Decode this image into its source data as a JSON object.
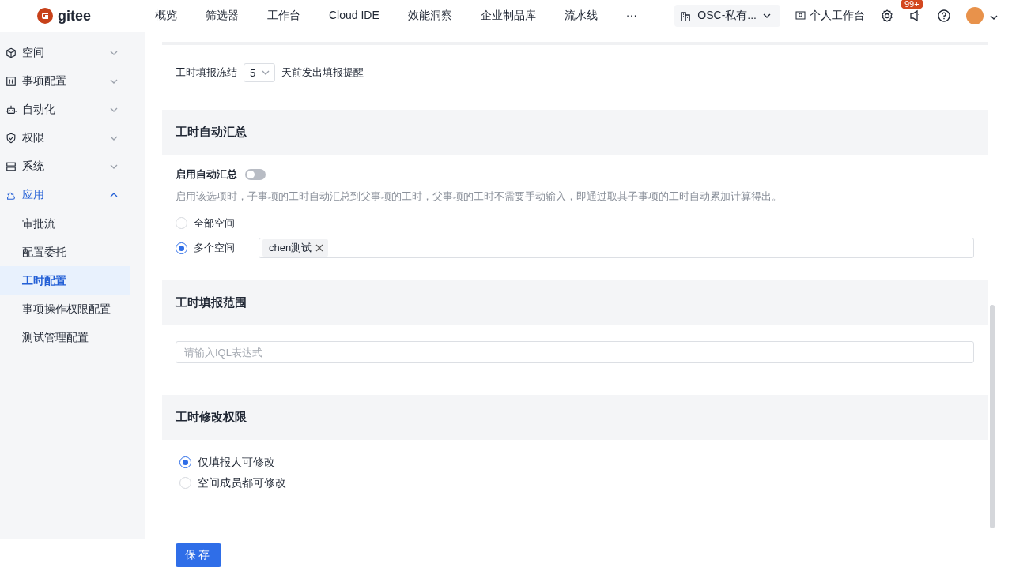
{
  "topbar": {
    "logo": "gitee",
    "nav": [
      {
        "label": "概览"
      },
      {
        "label": "筛选器"
      },
      {
        "label": "工作台"
      },
      {
        "label": "Cloud IDE"
      },
      {
        "label": "效能洞察"
      },
      {
        "label": "企业制品库"
      },
      {
        "label": "流水线"
      },
      {
        "label": "···"
      }
    ],
    "org_switcher": "OSC-私有...",
    "workbench": "个人工作台",
    "notification_badge": "99+"
  },
  "sidebar": {
    "items": [
      {
        "label": "空间",
        "expanded": false
      },
      {
        "label": "事项配置",
        "expanded": false
      },
      {
        "label": "自动化",
        "expanded": false
      },
      {
        "label": "权限",
        "expanded": false
      },
      {
        "label": "系统",
        "expanded": false
      },
      {
        "label": "应用",
        "expanded": true,
        "children": [
          {
            "label": "审批流",
            "selected": false
          },
          {
            "label": "配置委托",
            "selected": false
          },
          {
            "label": "工时配置",
            "selected": true
          },
          {
            "label": "事项操作权限配置",
            "selected": false
          },
          {
            "label": "测试管理配置",
            "selected": false
          }
        ]
      }
    ]
  },
  "freeze_row": {
    "label": "工时填报冻结",
    "value": "5",
    "suffix": "天前发出填报提醒"
  },
  "auto_summary": {
    "title": "工时自动汇总",
    "toggle": {
      "label": "启用自动汇总",
      "on": false
    },
    "description": "启用该选项时，子事项的工时自动汇总到父事项的工时，父事项的工时不需要手动输入，即通过取其子事项的工时自动累加计算得出。",
    "options": [
      {
        "label": "全部空间",
        "selected": false
      },
      {
        "label": "多个空间",
        "selected": true
      }
    ],
    "tags": [
      "chen测试"
    ]
  },
  "fill_scope": {
    "title": "工时填报范围",
    "iql_field": {
      "placeholder": "请输入IQL表达式"
    }
  },
  "edit_permission": {
    "title": "工时修改权限",
    "options": [
      {
        "label": "仅填报人可修改",
        "selected": true
      },
      {
        "label": "空间成员都可修改",
        "selected": false
      }
    ]
  },
  "save_button": "保存"
}
